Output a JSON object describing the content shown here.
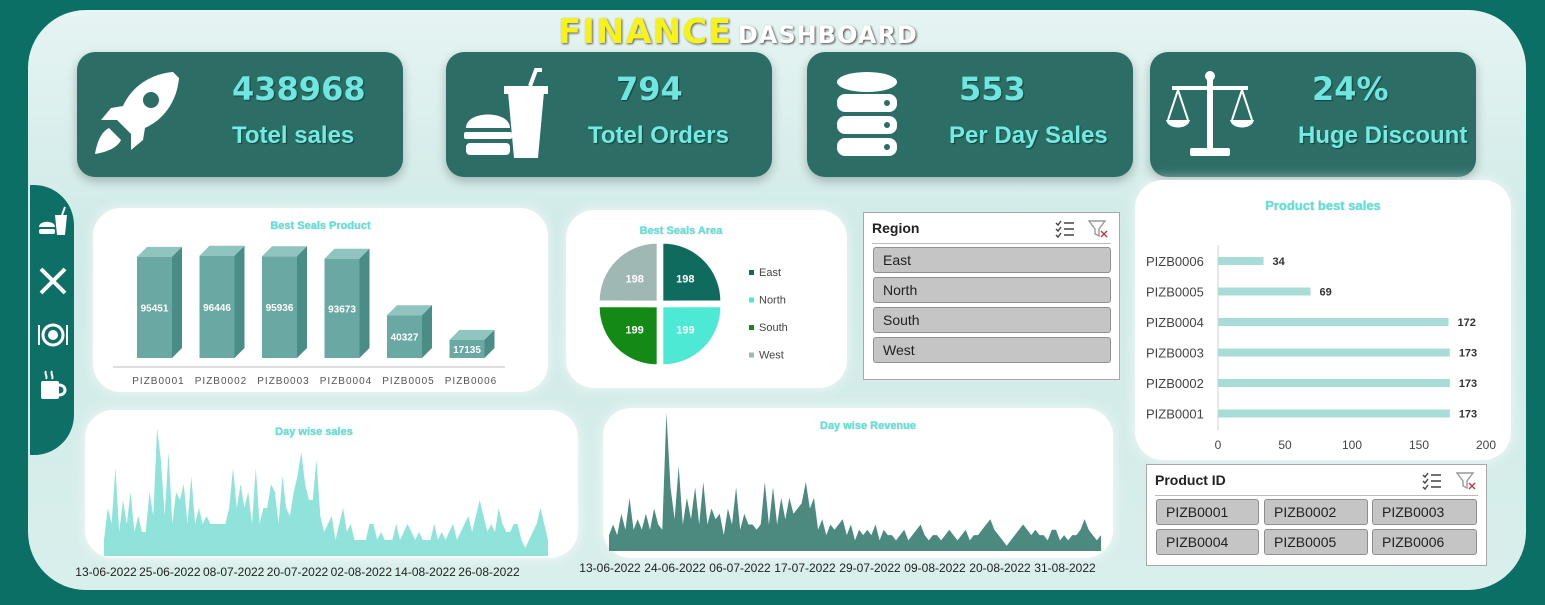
{
  "title": {
    "part1": "FINANCE",
    "part2": "DASHBOARD"
  },
  "kpis": [
    {
      "value": "438968",
      "label": "Totel sales",
      "icon": "rocket-icon"
    },
    {
      "value": "794",
      "label": "Totel Orders",
      "icon": "fast-food-icon"
    },
    {
      "value": "553",
      "label": "Per Day Sales",
      "icon": "database-icon"
    },
    {
      "value": "24%",
      "label": "Huge Discount",
      "icon": "scale-icon"
    }
  ],
  "side_icons": [
    "burger-drink-icon",
    "fork-knife-icon",
    "dining-plate-icon",
    "coffee-cup-icon"
  ],
  "colors": {
    "teal_dark": "#0b6f65",
    "kpi_bg": "#2c6d66",
    "kpi_text": "#6fe6df",
    "title_yellow": "#f6f21a",
    "bar": "#6aa8a3",
    "aqua": "#54e6dc"
  },
  "region_slicer": {
    "header": "Region",
    "items": [
      "East",
      "North",
      "South",
      "West"
    ]
  },
  "product_slicer": {
    "header": "Product ID",
    "items": [
      "PIZB0001",
      "PIZB0002",
      "PIZB0003",
      "PIZB0004",
      "PIZB0005",
      "PIZB0006"
    ]
  },
  "chart_data": [
    {
      "type": "bar",
      "title": "Best Seals Product",
      "categories": [
        "PIZB0001",
        "PIZB0002",
        "PIZB0003",
        "PIZB0004",
        "PIZB0005",
        "PIZB0006"
      ],
      "values": [
        95451,
        96446,
        95936,
        93673,
        40327,
        17135
      ],
      "ylim": [
        0,
        100000
      ]
    },
    {
      "type": "pie",
      "title": "Best Seals Area",
      "labels": [
        "East",
        "North",
        "South",
        "West"
      ],
      "values": [
        198,
        199,
        199,
        198
      ],
      "colors": [
        "#0e6b5e",
        "#4de9d5",
        "#138a16",
        "#9fb8b4"
      ]
    },
    {
      "type": "bar",
      "orientation": "horizontal",
      "title": "Product best sales",
      "categories": [
        "PIZB0006",
        "PIZB0005",
        "PIZB0004",
        "PIZB0003",
        "PIZB0002",
        "PIZB0001"
      ],
      "values": [
        34,
        69,
        172,
        173,
        173,
        173
      ],
      "xlim": [
        0,
        200
      ],
      "xticks": [
        "0",
        "50",
        "100",
        "150",
        "200"
      ]
    },
    {
      "type": "area",
      "title": "Day wise sales",
      "x_ticks": [
        "13-06-2022",
        "25-06-2022",
        "08-07-2022",
        "20-07-2022",
        "02-08-2022",
        "14-08-2022",
        "26-08-2022"
      ],
      "values": [
        2,
        6,
        4,
        11,
        3,
        7,
        4,
        8,
        3,
        5,
        3,
        3,
        8,
        5,
        16,
        12,
        5,
        13,
        4,
        8,
        7,
        9,
        4,
        10,
        4,
        6,
        4,
        5,
        4,
        4,
        4,
        4,
        4,
        6,
        11,
        6,
        9,
        6,
        8,
        4,
        11,
        4,
        6,
        6,
        9,
        8,
        4,
        10,
        6,
        5,
        8,
        10,
        13,
        9,
        7,
        7,
        12,
        5,
        3,
        4,
        5,
        2,
        4,
        6,
        3,
        4,
        2,
        2,
        2,
        2,
        4,
        4,
        2,
        3,
        2,
        2,
        2,
        4,
        2,
        3,
        4,
        3,
        2,
        3,
        2,
        2,
        2,
        4,
        2,
        3,
        2,
        3,
        4,
        2,
        3,
        4,
        5,
        3,
        5,
        7,
        5,
        3,
        4,
        3,
        6,
        4,
        3,
        3,
        4,
        4,
        2,
        1,
        2,
        3,
        4,
        6,
        4,
        2
      ]
    },
    {
      "type": "area",
      "title": "Day wise Revenue",
      "x_ticks": [
        "13-06-2022",
        "24-06-2022",
        "06-07-2022",
        "17-07-2022",
        "29-07-2022",
        "09-08-2022",
        "20-08-2022",
        "31-08-2022"
      ],
      "values": [
        3,
        5,
        3,
        7,
        4,
        10,
        4,
        6,
        4,
        7,
        4,
        8,
        5,
        4,
        26,
        12,
        6,
        16,
        5,
        10,
        6,
        12,
        5,
        13,
        5,
        8,
        6,
        7,
        3,
        8,
        5,
        12,
        4,
        7,
        5,
        5,
        4,
        5,
        13,
        5,
        12,
        5,
        10,
        6,
        10,
        7,
        8,
        9,
        13,
        8,
        10,
        4,
        6,
        3,
        5,
        4,
        5,
        6,
        3,
        5,
        2,
        4,
        3,
        4,
        3,
        5,
        2,
        4,
        3,
        3,
        2,
        3,
        4,
        2,
        3,
        4,
        5,
        3,
        2,
        3,
        3,
        2,
        3,
        4,
        3,
        2,
        3,
        4,
        2,
        3,
        3,
        4,
        5,
        6,
        4,
        3,
        2,
        1,
        2,
        3,
        4,
        5,
        4,
        3,
        4,
        3,
        3,
        2,
        4,
        4,
        2,
        3,
        2,
        3,
        3,
        4,
        6,
        4,
        3,
        2,
        3
      ]
    }
  ]
}
